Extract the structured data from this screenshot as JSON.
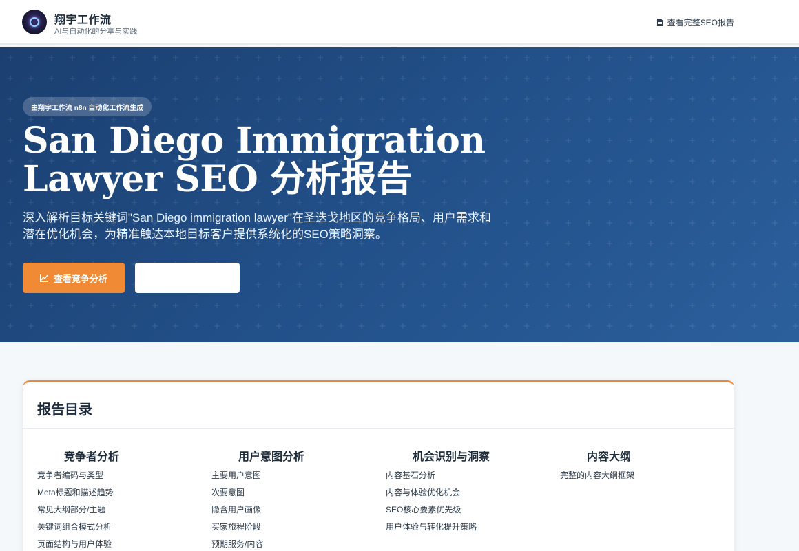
{
  "header": {
    "brand_title": "翔宇工作流",
    "brand_subtitle": "AI与自动化的分享与实践",
    "report_link": "查看完整SEO报告",
    "logo_icon": "brand-logo",
    "report_icon": "document-icon"
  },
  "hero": {
    "badge": "由翔宇工作流 n8n 自动化工作流生成",
    "title_line1": "San Diego Immigration",
    "title_line2": "Lawyer SEO 分析报告",
    "description": "深入解析目标关键词\"San Diego immigration lawyer\"在圣迭戈地区的竞争格局、用户需求和潜在优化机会，为精准触达本地目标客户提供系统化的SEO策略洞察。",
    "primary_button": "查看竞争分析",
    "primary_button_icon": "line-chart-icon",
    "secondary_button": "",
    "accent_color": "#f18a34",
    "background_color": "#225089"
  },
  "toc": {
    "title": "报告目录",
    "columns": [
      {
        "title": "竞争者分析",
        "items": [
          "竞争者编码与类型",
          "Meta标题和描述趋势",
          "常见大纲部分/主题",
          "关键词组合模式分析",
          "页面结构与用户体验"
        ]
      },
      {
        "title": "用户意图分析",
        "items": [
          "主要用户意图",
          "次要意图",
          "隐含用户画像",
          "买家旅程阶段",
          "预期服务/内容"
        ]
      },
      {
        "title": "机会识别与洞察",
        "items": [
          "内容基石分析",
          "内容与体验优化机会",
          "SEO核心要素优先级",
          "用户体验与转化提升策略"
        ]
      },
      {
        "title": "内容大纲",
        "items": [
          "完整的内容大纲框架"
        ]
      }
    ]
  }
}
